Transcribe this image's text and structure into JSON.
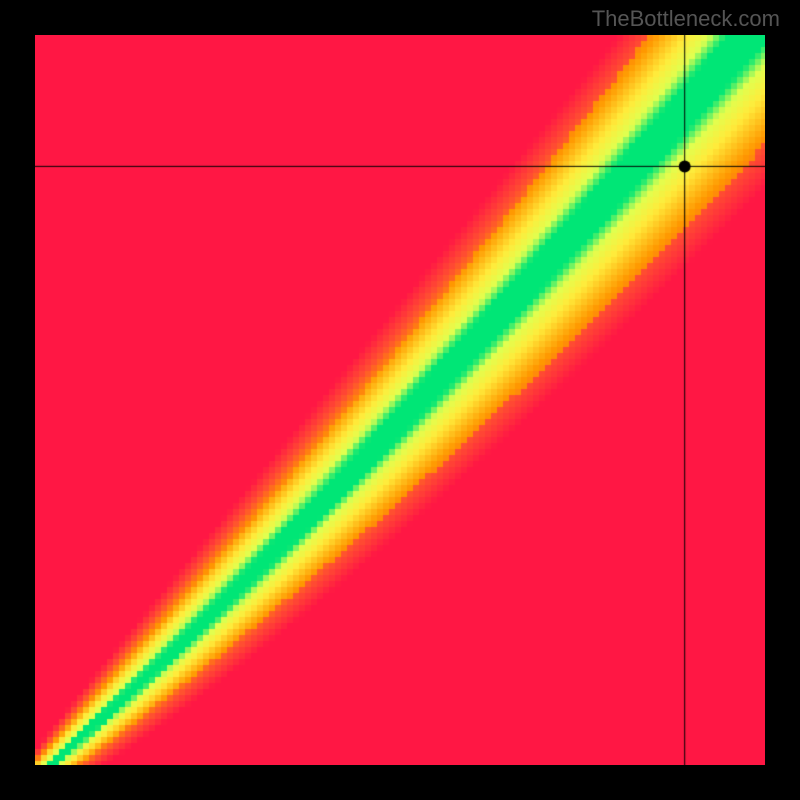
{
  "watermark": "TheBottleneck.com",
  "chart_data": {
    "type": "heatmap",
    "title": "",
    "xlabel": "",
    "ylabel": "",
    "xlim": [
      0,
      100
    ],
    "ylim": [
      0,
      100
    ],
    "marker": {
      "x": 89,
      "y": 82
    },
    "crosshair": {
      "x": 89,
      "y": 82
    },
    "description": "Bottleneck compatibility heatmap. Green diagonal band = balanced, red corners = severe bottleneck, yellow = transitional.",
    "band": {
      "center_slope": 1.05,
      "center_offset": -2,
      "curve": 0.15,
      "width_min": 2,
      "width_max": 18
    },
    "colors": {
      "severe": "#ff1744",
      "high": "#ff5030",
      "mid": "#ff9800",
      "transitional": "#ffeb3b",
      "near": "#e0ff4f",
      "balanced": "#00e676"
    }
  }
}
